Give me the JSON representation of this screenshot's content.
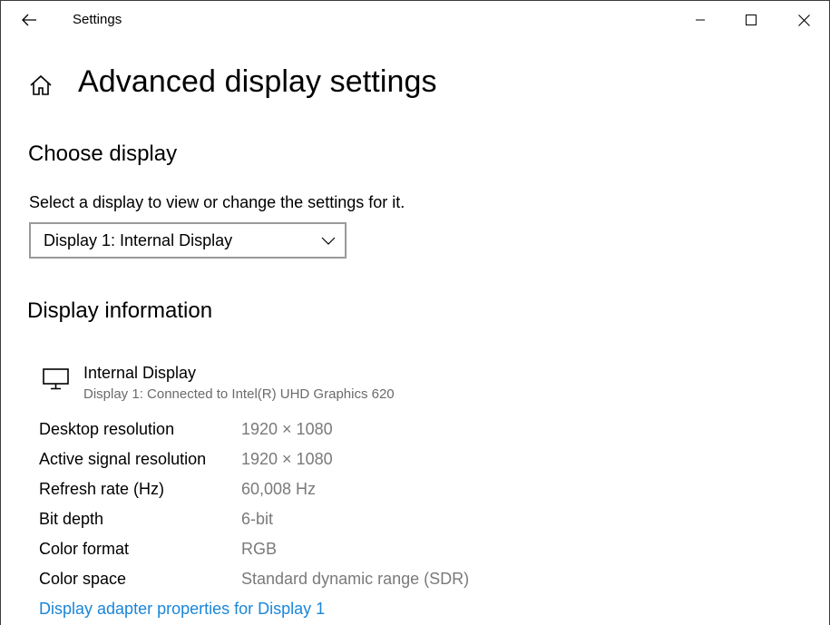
{
  "titlebar": {
    "app_title": "Settings",
    "back_icon": "back-arrow-icon",
    "minimize_icon": "minimize-icon",
    "maximize_icon": "maximize-icon",
    "close_icon": "close-icon"
  },
  "page": {
    "home_icon": "home-icon",
    "title": "Advanced display settings"
  },
  "choose_display": {
    "heading": "Choose display",
    "description": "Select a display to view or change the settings for it.",
    "selected": "Display 1: Internal Display"
  },
  "display_info": {
    "heading": "Display information",
    "monitor_icon": "monitor-icon",
    "name": "Internal Display",
    "connection": "Display 1: Connected to Intel(R) UHD Graphics 620",
    "rows": [
      {
        "label": "Desktop resolution",
        "value": "1920 × 1080"
      },
      {
        "label": "Active signal resolution",
        "value": "1920 × 1080"
      },
      {
        "label": "Refresh rate (Hz)",
        "value": "60,008 Hz"
      },
      {
        "label": "Bit depth",
        "value": "6-bit"
      },
      {
        "label": "Color format",
        "value": "RGB"
      },
      {
        "label": "Color space",
        "value": "Standard dynamic range (SDR)"
      }
    ],
    "adapter_link": "Display adapter properties for Display 1"
  },
  "colors": {
    "link": "#1a86d9",
    "secondary_text": "#7a7a7a"
  }
}
